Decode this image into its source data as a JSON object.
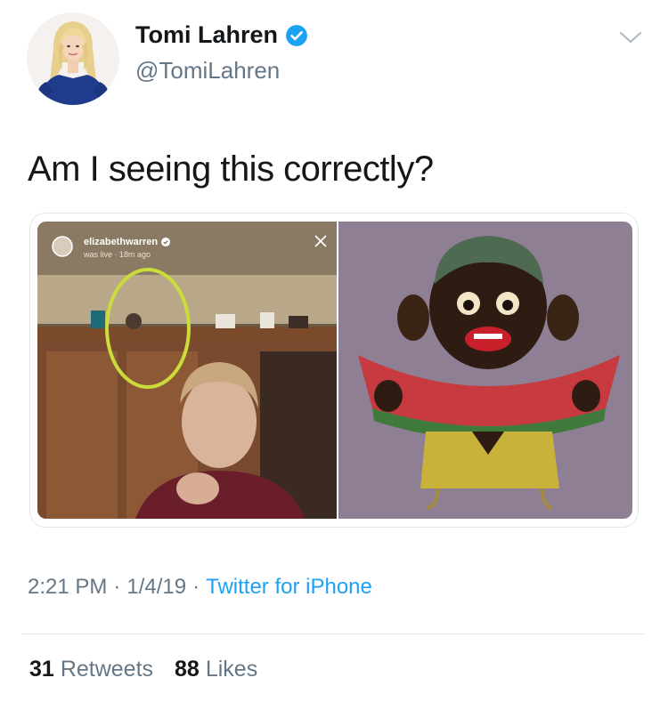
{
  "tweet": {
    "author_name": "Tomi Lahren",
    "handle": "@TomiLahren",
    "verified": true,
    "text": "Am I seeing this correctly?",
    "time": "2:21 PM",
    "date": "1/4/19",
    "source": "Twitter for iPhone",
    "separator": "·"
  },
  "media": {
    "left_image": {
      "description_icon": "instagram-live-screenshot",
      "ig_username": "elizabethwarren",
      "ig_status": "was live · 18m ago",
      "highlight_color": "#c9dc3a"
    },
    "right_image": {
      "description_icon": "watermelon-figurine-photo"
    }
  },
  "stats": {
    "retweets_count": "31",
    "retweets_label": "Retweets",
    "likes_count": "88",
    "likes_label": "Likes"
  },
  "colors": {
    "verified_blue": "#1da1f2",
    "text_primary": "#14171a",
    "text_secondary": "#657786",
    "link": "#1da1f2",
    "divider": "#e1e8ed"
  },
  "icons": {
    "verified": "verified-badge-icon",
    "caret": "chevron-down-icon",
    "close": "close-icon"
  }
}
